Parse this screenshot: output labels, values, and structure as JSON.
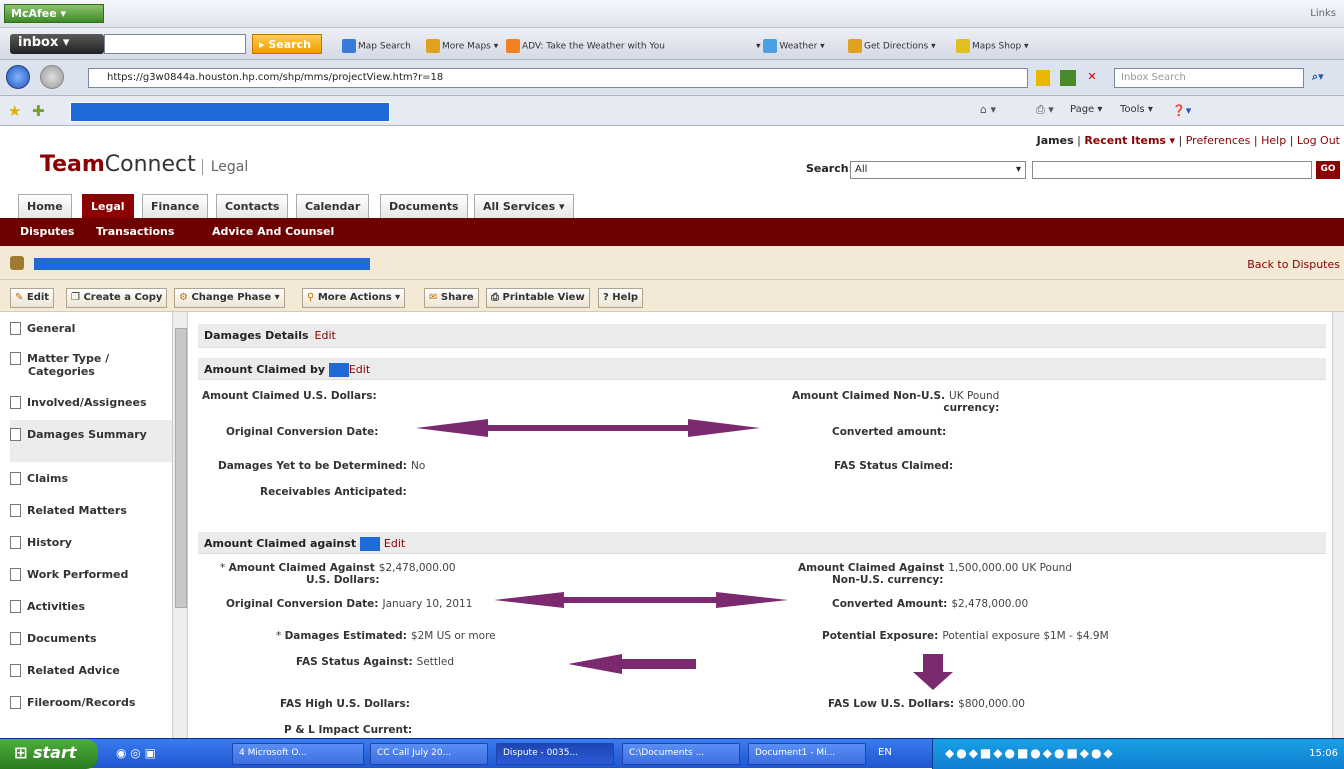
{
  "browser": {
    "mcafee_label": "McAfee",
    "links_label": "Links",
    "inbox_label": "inbox",
    "search_button": "Search",
    "toolbar_items": [
      "Map Search",
      "More Maps",
      "ADV: Take the Weather with You",
      "Weather",
      "Get Directions",
      "Maps Shop"
    ],
    "address": "https://g3w0844a.houston.hp.com/shp/mms/projectView.htm?r=18",
    "inbox_search_placeholder": "Inbox Search",
    "ie_toolbar": [
      "Page",
      "Tools"
    ]
  },
  "app": {
    "logo_bold": "Team",
    "logo_rest": "Connect",
    "logo_sub": "Legal",
    "user_name": "James",
    "recent_items": "Recent Items",
    "preferences": "Preferences",
    "help": "Help",
    "logout": "Log Out",
    "search_label": "Search:",
    "search_scope": "All",
    "go_label": "GO",
    "tabs": [
      "Home",
      "Legal",
      "Finance",
      "Contacts",
      "Calendar",
      "Documents",
      "All Services"
    ],
    "subnav": [
      "Disputes",
      "Transactions",
      "Advice And Counsel"
    ],
    "back_link": "Back to Disputes",
    "actions": [
      "Edit",
      "Create a Copy",
      "Change Phase",
      "More Actions",
      "Share",
      "Printable View",
      "Help"
    ]
  },
  "sidebar": {
    "items": [
      "General",
      "Matter Type / Categories",
      "Involved/Assignees",
      "Damages Summary",
      "Claims",
      "Related Matters",
      "History",
      "Work Performed",
      "Activities",
      "Documents",
      "Related Advice",
      "Fileroom/Records"
    ]
  },
  "main": {
    "damages_details": "Damages Details",
    "edit": "Edit",
    "claimed_by_title": "Amount Claimed by",
    "claimed_against_title": "Amount Claimed against",
    "by": {
      "usd_label": "Amount Claimed U.S. Dollars:",
      "nonus_label_1": "Amount Claimed Non-U.S.",
      "nonus_label_2": "currency:",
      "nonus_value": "UK Pound",
      "conv_date_label": "Original Conversion Date:",
      "converted_label": "Converted amount:",
      "ytbd_label": "Damages Yet to be Determined:",
      "ytbd_value": "No",
      "fas_claimed_label": "FAS Status Claimed:",
      "receivables_label": "Receivables Anticipated:"
    },
    "against": {
      "usd_label_1": "Amount Claimed Against",
      "usd_label_2": "U.S. Dollars:",
      "usd_value": "$2,478,000.00",
      "nonus_label_1": "Amount Claimed Against",
      "nonus_label_2": "Non-U.S. currency:",
      "nonus_value": "1,500,000.00 UK Pound",
      "conv_date_label": "Original Conversion Date:",
      "conv_date_value": "January 10, 2011",
      "converted_label": "Converted Amount:",
      "converted_value": "$2,478,000.00",
      "dmg_est_label": "Damages Estimated:",
      "dmg_est_value": "$2M US or more",
      "exposure_label": "Potential Exposure:",
      "exposure_value": "Potential exposure $1M - $4.9M",
      "fas_against_label": "FAS Status Against:",
      "fas_against_value": "Settled",
      "fas_high_label": "FAS High U.S. Dollars:",
      "fas_low_label": "FAS Low U.S. Dollars:",
      "fas_low_value": "$800,000.00",
      "pl_label": "P & L Impact Current:"
    },
    "arrow_color": "#7b2a6f"
  },
  "taskbar": {
    "start": "start",
    "buttons": [
      "4 Microsoft O...",
      "CC Call July 20...",
      "Dispute - 0035...",
      "C:\\Documents ...",
      "Document1 - Mi..."
    ],
    "lang": "EN",
    "clock": "15:06"
  },
  "colors": {
    "brand": "#8b0000",
    "highlight_blue": "#1e6ad6"
  }
}
